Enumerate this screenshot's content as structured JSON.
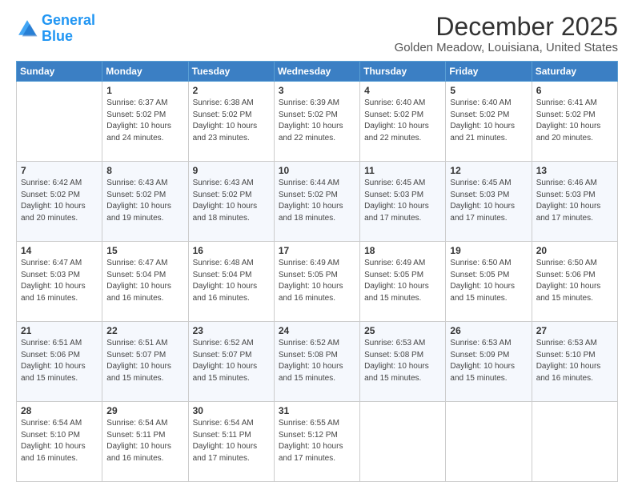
{
  "logo": {
    "line1": "General",
    "line2": "Blue"
  },
  "header": {
    "month": "December 2025",
    "location": "Golden Meadow, Louisiana, United States"
  },
  "weekdays": [
    "Sunday",
    "Monday",
    "Tuesday",
    "Wednesday",
    "Thursday",
    "Friday",
    "Saturday"
  ],
  "weeks": [
    [
      {
        "day": "",
        "sunrise": "",
        "sunset": "",
        "daylight": ""
      },
      {
        "day": "1",
        "sunrise": "Sunrise: 6:37 AM",
        "sunset": "Sunset: 5:02 PM",
        "daylight": "Daylight: 10 hours and 24 minutes."
      },
      {
        "day": "2",
        "sunrise": "Sunrise: 6:38 AM",
        "sunset": "Sunset: 5:02 PM",
        "daylight": "Daylight: 10 hours and 23 minutes."
      },
      {
        "day": "3",
        "sunrise": "Sunrise: 6:39 AM",
        "sunset": "Sunset: 5:02 PM",
        "daylight": "Daylight: 10 hours and 22 minutes."
      },
      {
        "day": "4",
        "sunrise": "Sunrise: 6:40 AM",
        "sunset": "Sunset: 5:02 PM",
        "daylight": "Daylight: 10 hours and 22 minutes."
      },
      {
        "day": "5",
        "sunrise": "Sunrise: 6:40 AM",
        "sunset": "Sunset: 5:02 PM",
        "daylight": "Daylight: 10 hours and 21 minutes."
      },
      {
        "day": "6",
        "sunrise": "Sunrise: 6:41 AM",
        "sunset": "Sunset: 5:02 PM",
        "daylight": "Daylight: 10 hours and 20 minutes."
      }
    ],
    [
      {
        "day": "7",
        "sunrise": "Sunrise: 6:42 AM",
        "sunset": "Sunset: 5:02 PM",
        "daylight": "Daylight: 10 hours and 20 minutes."
      },
      {
        "day": "8",
        "sunrise": "Sunrise: 6:43 AM",
        "sunset": "Sunset: 5:02 PM",
        "daylight": "Daylight: 10 hours and 19 minutes."
      },
      {
        "day": "9",
        "sunrise": "Sunrise: 6:43 AM",
        "sunset": "Sunset: 5:02 PM",
        "daylight": "Daylight: 10 hours and 18 minutes."
      },
      {
        "day": "10",
        "sunrise": "Sunrise: 6:44 AM",
        "sunset": "Sunset: 5:02 PM",
        "daylight": "Daylight: 10 hours and 18 minutes."
      },
      {
        "day": "11",
        "sunrise": "Sunrise: 6:45 AM",
        "sunset": "Sunset: 5:03 PM",
        "daylight": "Daylight: 10 hours and 17 minutes."
      },
      {
        "day": "12",
        "sunrise": "Sunrise: 6:45 AM",
        "sunset": "Sunset: 5:03 PM",
        "daylight": "Daylight: 10 hours and 17 minutes."
      },
      {
        "day": "13",
        "sunrise": "Sunrise: 6:46 AM",
        "sunset": "Sunset: 5:03 PM",
        "daylight": "Daylight: 10 hours and 17 minutes."
      }
    ],
    [
      {
        "day": "14",
        "sunrise": "Sunrise: 6:47 AM",
        "sunset": "Sunset: 5:03 PM",
        "daylight": "Daylight: 10 hours and 16 minutes."
      },
      {
        "day": "15",
        "sunrise": "Sunrise: 6:47 AM",
        "sunset": "Sunset: 5:04 PM",
        "daylight": "Daylight: 10 hours and 16 minutes."
      },
      {
        "day": "16",
        "sunrise": "Sunrise: 6:48 AM",
        "sunset": "Sunset: 5:04 PM",
        "daylight": "Daylight: 10 hours and 16 minutes."
      },
      {
        "day": "17",
        "sunrise": "Sunrise: 6:49 AM",
        "sunset": "Sunset: 5:05 PM",
        "daylight": "Daylight: 10 hours and 16 minutes."
      },
      {
        "day": "18",
        "sunrise": "Sunrise: 6:49 AM",
        "sunset": "Sunset: 5:05 PM",
        "daylight": "Daylight: 10 hours and 15 minutes."
      },
      {
        "day": "19",
        "sunrise": "Sunrise: 6:50 AM",
        "sunset": "Sunset: 5:05 PM",
        "daylight": "Daylight: 10 hours and 15 minutes."
      },
      {
        "day": "20",
        "sunrise": "Sunrise: 6:50 AM",
        "sunset": "Sunset: 5:06 PM",
        "daylight": "Daylight: 10 hours and 15 minutes."
      }
    ],
    [
      {
        "day": "21",
        "sunrise": "Sunrise: 6:51 AM",
        "sunset": "Sunset: 5:06 PM",
        "daylight": "Daylight: 10 hours and 15 minutes."
      },
      {
        "day": "22",
        "sunrise": "Sunrise: 6:51 AM",
        "sunset": "Sunset: 5:07 PM",
        "daylight": "Daylight: 10 hours and 15 minutes."
      },
      {
        "day": "23",
        "sunrise": "Sunrise: 6:52 AM",
        "sunset": "Sunset: 5:07 PM",
        "daylight": "Daylight: 10 hours and 15 minutes."
      },
      {
        "day": "24",
        "sunrise": "Sunrise: 6:52 AM",
        "sunset": "Sunset: 5:08 PM",
        "daylight": "Daylight: 10 hours and 15 minutes."
      },
      {
        "day": "25",
        "sunrise": "Sunrise: 6:53 AM",
        "sunset": "Sunset: 5:08 PM",
        "daylight": "Daylight: 10 hours and 15 minutes."
      },
      {
        "day": "26",
        "sunrise": "Sunrise: 6:53 AM",
        "sunset": "Sunset: 5:09 PM",
        "daylight": "Daylight: 10 hours and 15 minutes."
      },
      {
        "day": "27",
        "sunrise": "Sunrise: 6:53 AM",
        "sunset": "Sunset: 5:10 PM",
        "daylight": "Daylight: 10 hours and 16 minutes."
      }
    ],
    [
      {
        "day": "28",
        "sunrise": "Sunrise: 6:54 AM",
        "sunset": "Sunset: 5:10 PM",
        "daylight": "Daylight: 10 hours and 16 minutes."
      },
      {
        "day": "29",
        "sunrise": "Sunrise: 6:54 AM",
        "sunset": "Sunset: 5:11 PM",
        "daylight": "Daylight: 10 hours and 16 minutes."
      },
      {
        "day": "30",
        "sunrise": "Sunrise: 6:54 AM",
        "sunset": "Sunset: 5:11 PM",
        "daylight": "Daylight: 10 hours and 17 minutes."
      },
      {
        "day": "31",
        "sunrise": "Sunrise: 6:55 AM",
        "sunset": "Sunset: 5:12 PM",
        "daylight": "Daylight: 10 hours and 17 minutes."
      },
      {
        "day": "",
        "sunrise": "",
        "sunset": "",
        "daylight": ""
      },
      {
        "day": "",
        "sunrise": "",
        "sunset": "",
        "daylight": ""
      },
      {
        "day": "",
        "sunrise": "",
        "sunset": "",
        "daylight": ""
      }
    ]
  ]
}
